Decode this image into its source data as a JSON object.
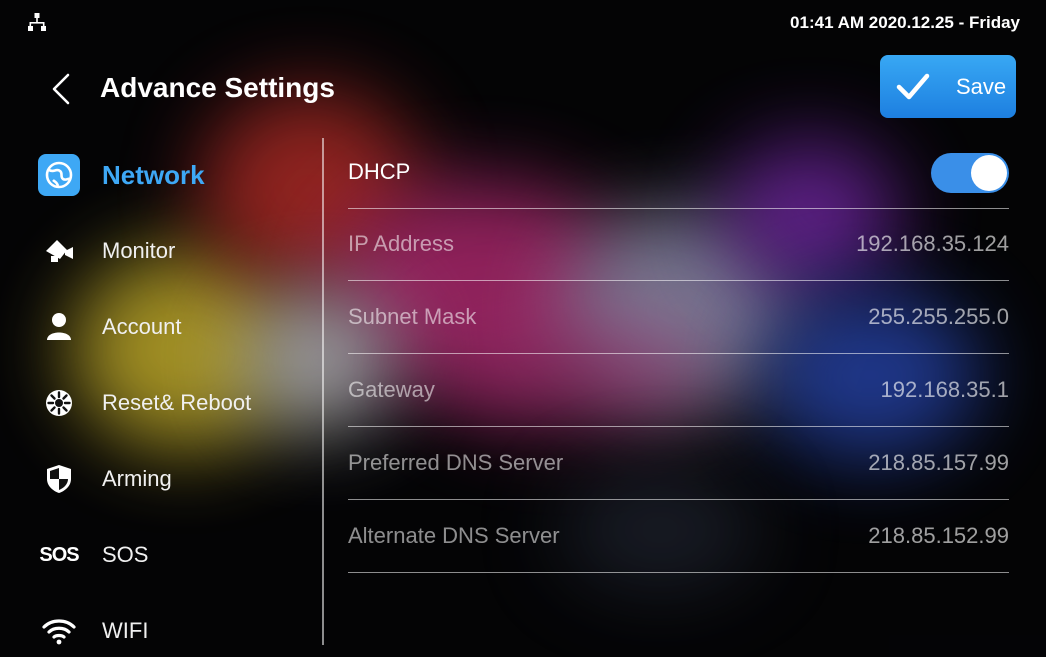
{
  "status_bar": {
    "network_icon": "network-tree-icon",
    "datetime": "01:41 AM  2020.12.25 - Friday"
  },
  "header": {
    "title": "Advance Settings",
    "back_icon": "chevron-left-icon",
    "save_label": "Save",
    "save_icon": "check-icon",
    "accent_color": "#3EA8F5"
  },
  "sidebar": {
    "items": [
      {
        "label": "Network",
        "icon": "network-globe-icon",
        "active": true
      },
      {
        "label": "Monitor",
        "icon": "camera-icon",
        "active": false
      },
      {
        "label": "Account",
        "icon": "person-icon",
        "active": false
      },
      {
        "label": "Reset& Reboot",
        "icon": "reset-gear-icon",
        "active": false
      },
      {
        "label": "Arming",
        "icon": "shield-icon",
        "active": false
      },
      {
        "label": "SOS",
        "icon": "sos-icon",
        "icon_text": "SOS",
        "active": false
      },
      {
        "label": "WIFI",
        "icon": "wifi-icon",
        "active": false
      }
    ]
  },
  "network": {
    "dhcp": {
      "label": "DHCP",
      "enabled": true
    },
    "fields": [
      {
        "label": "IP Address",
        "value": "192.168.35.124"
      },
      {
        "label": "Subnet Mask",
        "value": "255.255.255.0"
      },
      {
        "label": "Gateway",
        "value": "192.168.35.1"
      },
      {
        "label": "Preferred DNS Server",
        "value": "218.85.157.99"
      },
      {
        "label": "Alternate DNS Server",
        "value": "218.85.152.99"
      }
    ]
  }
}
